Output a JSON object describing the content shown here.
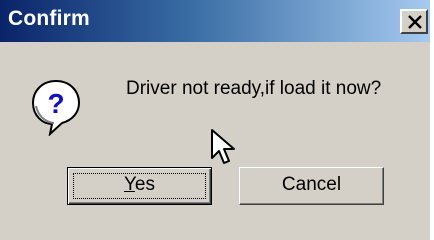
{
  "dialog": {
    "title": "Confirm",
    "close_glyph": "×",
    "message": "Driver not ready,if load it now?",
    "icon": "question-icon",
    "buttons": {
      "yes": {
        "mnemonic": "Y",
        "rest": "es"
      },
      "cancel": {
        "label": "Cancel"
      }
    }
  },
  "colors": {
    "face": "#d4d0c8",
    "title_start": "#0a246a",
    "title_end": "#a6caf0",
    "icon_blue": "#1010c8"
  }
}
